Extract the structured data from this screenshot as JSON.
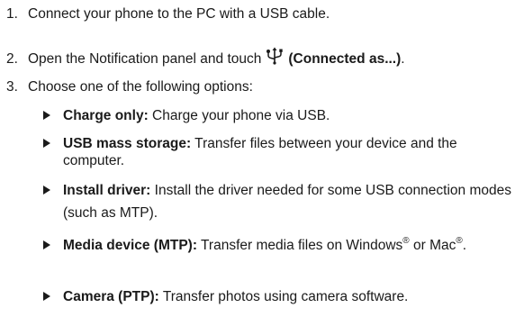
{
  "steps": [
    {
      "num": "1.",
      "text": "Connect your phone to the PC with a USB cable."
    },
    {
      "num": "2.",
      "text_before": "Open the Notification panel and touch",
      "icon": "usb-icon",
      "bold": "(Connected as...)",
      "text_after": "."
    },
    {
      "num": "3.",
      "text": "Choose one of the following options:"
    }
  ],
  "options": [
    {
      "label": "Charge only:",
      "text": "Charge your phone via USB."
    },
    {
      "label": "USB mass storage:",
      "text": "Transfer files between your device and the computer."
    },
    {
      "label": "Install driver:",
      "text": "Install the driver needed for some USB connection modes (such as MTP)."
    },
    {
      "label": "Media device (MTP):",
      "text_a": "Transfer media files on Windows",
      "sup_a": "®",
      "text_b": "or Mac",
      "sup_b": "®",
      "text_c": "."
    },
    {
      "label": "Camera (PTP):",
      "text": "Transfer photos using camera software."
    }
  ]
}
